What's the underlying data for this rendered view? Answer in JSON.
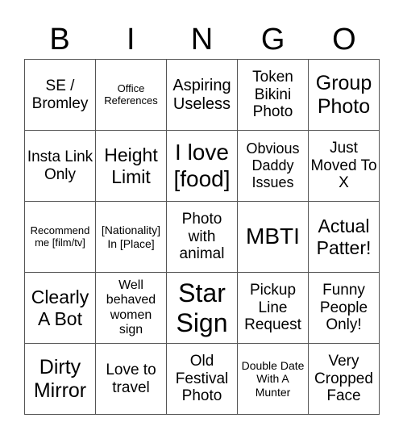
{
  "header": [
    "B",
    "I",
    "N",
    "G",
    "O"
  ],
  "cells": [
    "SE / Bromley",
    "Office References",
    "Aspiring Useless",
    "Token Bikini Photo",
    "Group Photo",
    "Insta Link Only",
    "Height Limit",
    "I love [food]",
    "Obvious Daddy Issues",
    "Just Moved To X",
    "Recommend me [film/tv]",
    "[Nationality] In [Place]",
    "Photo with animal",
    "MBTI",
    "Actual Patter!",
    "Clearly A Bot",
    "Well behaved women sign",
    "Star Sign",
    "Pickup Line Request",
    "Funny People Only!",
    "Dirty Mirror",
    "Love to travel",
    "Old Festival Photo",
    "Double Date With A Munter",
    "Very Cropped Face"
  ]
}
